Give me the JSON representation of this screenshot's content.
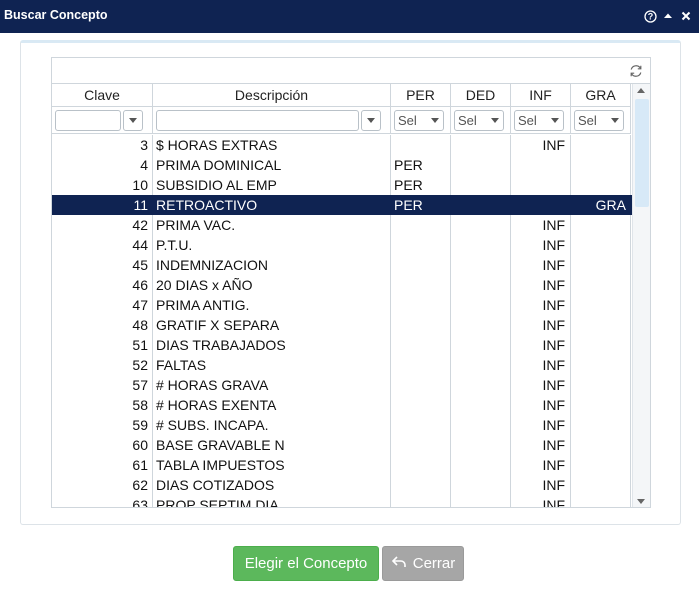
{
  "window": {
    "title": "Buscar Concepto"
  },
  "grid": {
    "columns": [
      "Clave",
      "Descripción",
      "PER",
      "DED",
      "INF",
      "GRA"
    ],
    "filter_placeholder": "Sel",
    "rows": [
      {
        "clave": "3",
        "descripcion": "$ HORAS EXTRAS",
        "per": "",
        "ded": "",
        "inf": "INF",
        "gra": ""
      },
      {
        "clave": "4",
        "descripcion": "PRIMA DOMINICAL",
        "per": "PER",
        "ded": "",
        "inf": "",
        "gra": ""
      },
      {
        "clave": "10",
        "descripcion": "SUBSIDIO AL EMP",
        "per": "PER",
        "ded": "",
        "inf": "",
        "gra": ""
      },
      {
        "clave": "11",
        "descripcion": "RETROACTIVO",
        "per": "PER",
        "ded": "",
        "inf": "",
        "gra": "GRA",
        "selected": true
      },
      {
        "clave": "42",
        "descripcion": "PRIMA VAC.",
        "per": "",
        "ded": "",
        "inf": "INF",
        "gra": ""
      },
      {
        "clave": "44",
        "descripcion": "P.T.U.",
        "per": "",
        "ded": "",
        "inf": "INF",
        "gra": ""
      },
      {
        "clave": "45",
        "descripcion": "INDEMNIZACION",
        "per": "",
        "ded": "",
        "inf": "INF",
        "gra": ""
      },
      {
        "clave": "46",
        "descripcion": "20 DIAS x AÑO",
        "per": "",
        "ded": "",
        "inf": "INF",
        "gra": ""
      },
      {
        "clave": "47",
        "descripcion": "PRIMA ANTIG.",
        "per": "",
        "ded": "",
        "inf": "INF",
        "gra": ""
      },
      {
        "clave": "48",
        "descripcion": "GRATIF X SEPARA",
        "per": "",
        "ded": "",
        "inf": "INF",
        "gra": ""
      },
      {
        "clave": "51",
        "descripcion": "DIAS TRABAJADOS",
        "per": "",
        "ded": "",
        "inf": "INF",
        "gra": ""
      },
      {
        "clave": "52",
        "descripcion": "FALTAS",
        "per": "",
        "ded": "",
        "inf": "INF",
        "gra": ""
      },
      {
        "clave": "57",
        "descripcion": "# HORAS GRAVA",
        "per": "",
        "ded": "",
        "inf": "INF",
        "gra": ""
      },
      {
        "clave": "58",
        "descripcion": "# HORAS EXENTA",
        "per": "",
        "ded": "",
        "inf": "INF",
        "gra": ""
      },
      {
        "clave": "59",
        "descripcion": "# SUBS. INCAPA.",
        "per": "",
        "ded": "",
        "inf": "INF",
        "gra": ""
      },
      {
        "clave": "60",
        "descripcion": "BASE GRAVABLE N",
        "per": "",
        "ded": "",
        "inf": "INF",
        "gra": ""
      },
      {
        "clave": "61",
        "descripcion": "TABLA IMPUESTOS",
        "per": "",
        "ded": "",
        "inf": "INF",
        "gra": ""
      },
      {
        "clave": "62",
        "descripcion": "DIAS COTIZADOS",
        "per": "",
        "ded": "",
        "inf": "INF",
        "gra": ""
      },
      {
        "clave": "63",
        "descripcion": "PROP SEPTIM DIA",
        "per": "",
        "ded": "",
        "inf": "INF",
        "gra": ""
      }
    ]
  },
  "buttons": {
    "choose": "Elegir el Concepto",
    "close": "Cerrar"
  },
  "colors": {
    "titlebar": "#0f2352",
    "selected_row": "#0f2352",
    "ok_button": "#5cb85c",
    "close_button": "#a6a6a6"
  },
  "icons": {
    "help": "help-icon",
    "collapse": "collapse-icon",
    "close": "close-icon",
    "refresh": "refresh-icon",
    "undo": "undo-icon"
  }
}
